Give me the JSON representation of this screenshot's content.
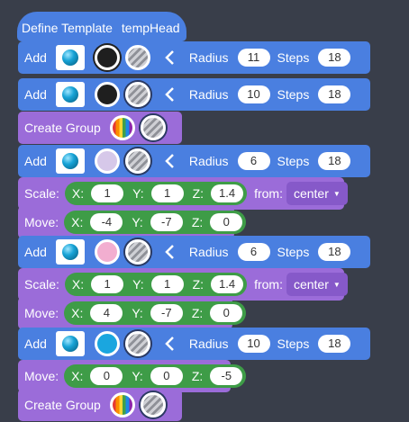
{
  "header": {
    "define_label": "Define Template",
    "template_name": "tempHead"
  },
  "common": {
    "add": "Add",
    "radius": "Radius",
    "steps": "Steps",
    "create_group": "Create Group",
    "scale": "Scale:",
    "move": "Move:",
    "from": "from:",
    "x": "X:",
    "y": "Y:",
    "z": "Z:"
  },
  "colors": {
    "black": "#1f1f1f",
    "lavender": "#d6c8e9",
    "pink": "#f2aed0",
    "blue": "#1aa6df",
    "block_blue": "#4a7fe0",
    "block_purple": "#9b6cd9",
    "green": "#3e9c47"
  },
  "blocks": [
    {
      "type": "add",
      "color": "black",
      "radius": "11",
      "steps": "18"
    },
    {
      "type": "add",
      "color": "black",
      "radius": "10",
      "steps": "18"
    },
    {
      "type": "create_group"
    },
    {
      "type": "add",
      "color": "lavender",
      "radius": "6",
      "steps": "18"
    },
    {
      "type": "scale",
      "x": "1",
      "y": "1",
      "z": "1.4",
      "origin": "center"
    },
    {
      "type": "move",
      "x": "-4",
      "y": "-7",
      "z": "0"
    },
    {
      "type": "add",
      "color": "pink",
      "radius": "6",
      "steps": "18"
    },
    {
      "type": "scale",
      "x": "1",
      "y": "1",
      "z": "1.4",
      "origin": "center"
    },
    {
      "type": "move",
      "x": "4",
      "y": "-7",
      "z": "0"
    },
    {
      "type": "add",
      "color": "blue",
      "radius": "10",
      "steps": "18"
    },
    {
      "type": "move",
      "x": "0",
      "y": "0",
      "z": "-5"
    },
    {
      "type": "create_group"
    }
  ]
}
